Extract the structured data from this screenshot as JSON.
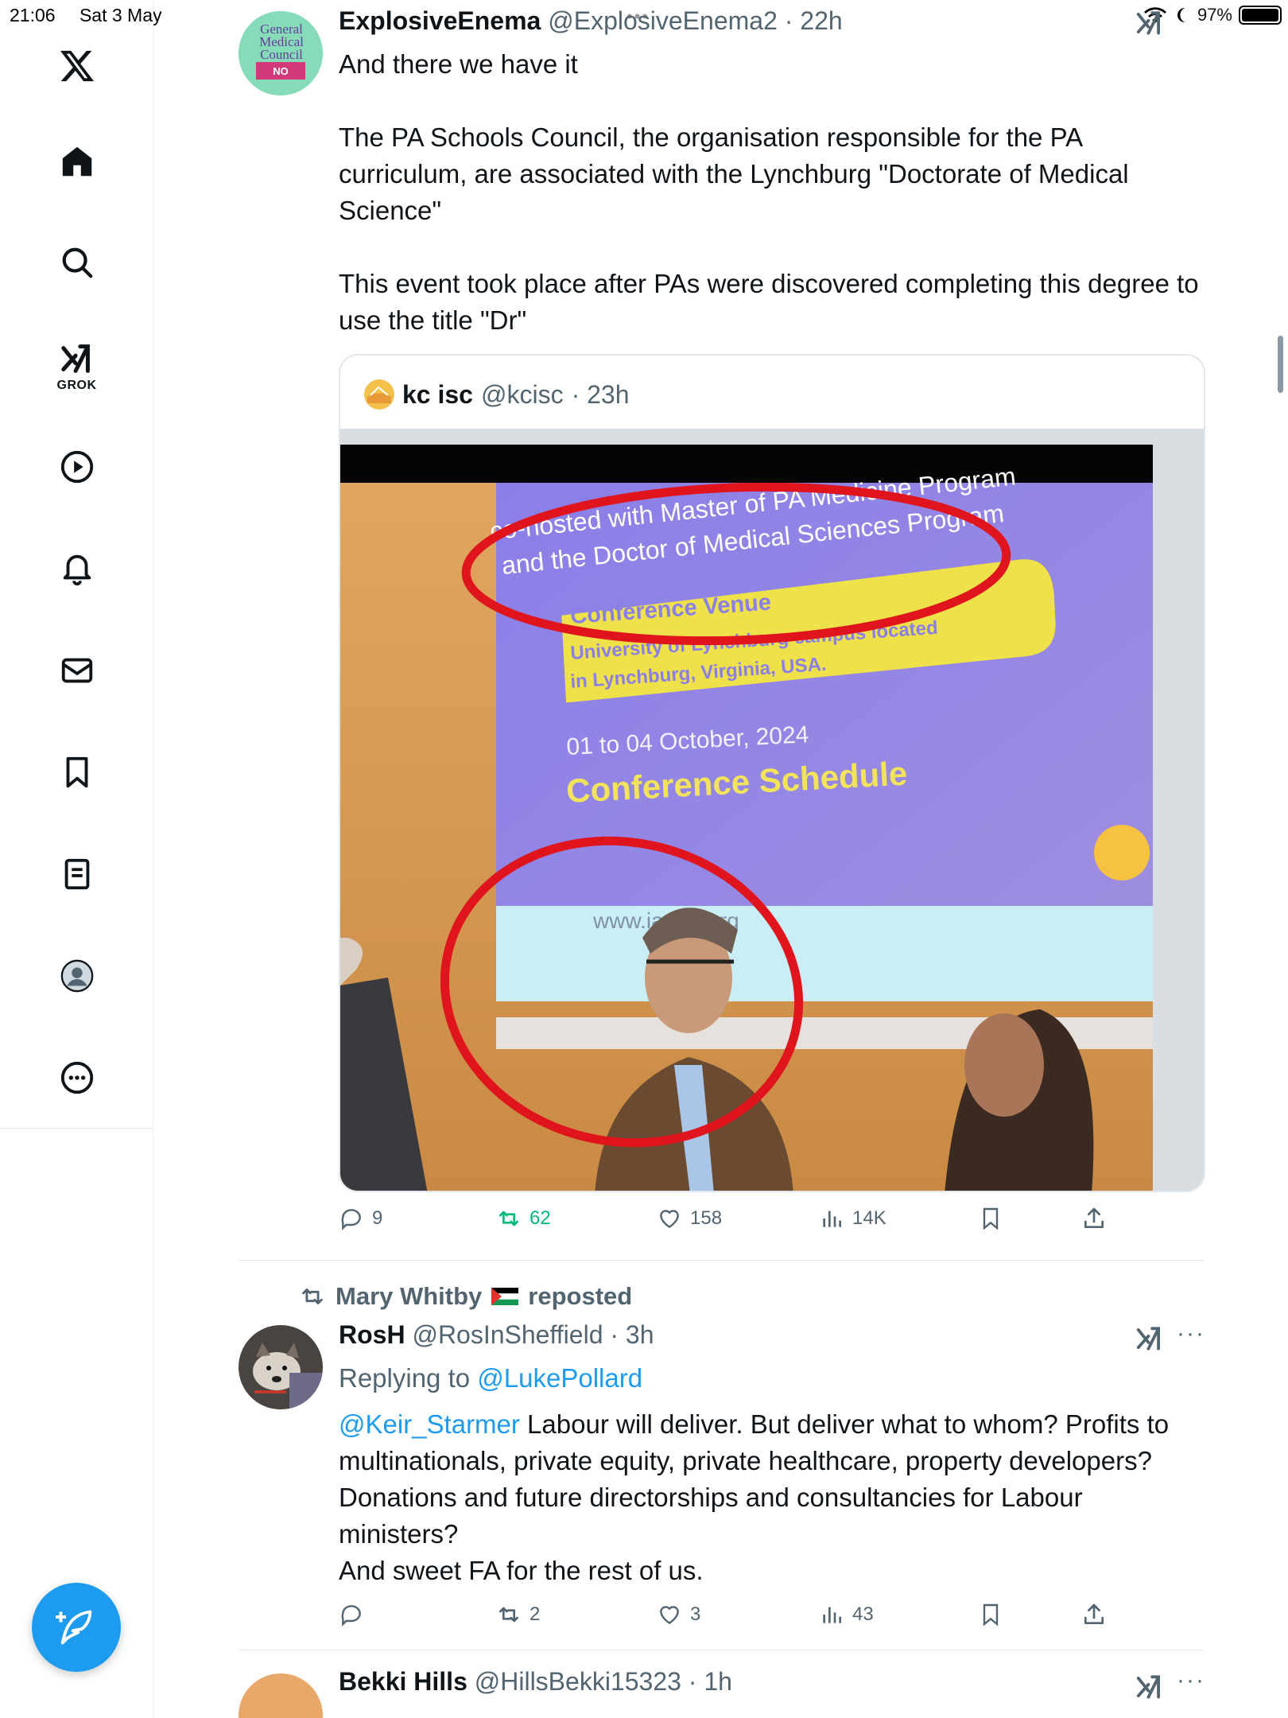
{
  "status": {
    "time": "21:06",
    "date": "Sat 3 May",
    "battery": "97%",
    "battery_level": 0.97
  },
  "sidebar": {
    "items": [
      {
        "icon": "x-logo-icon"
      },
      {
        "icon": "home-icon"
      },
      {
        "icon": "search-icon"
      },
      {
        "icon": "grok-icon",
        "label": "GROK"
      },
      {
        "icon": "play-icon"
      },
      {
        "icon": "bell-icon"
      },
      {
        "icon": "mail-icon"
      },
      {
        "icon": "bookmark-icon"
      },
      {
        "icon": "article-icon"
      },
      {
        "icon": "profile-icon"
      },
      {
        "icon": "more-circle-icon"
      }
    ],
    "compose_icon": "compose-feather-icon"
  },
  "posts": [
    {
      "name": "ExplosiveEnema",
      "handle": "@ExplosiveEnema2",
      "time": "· 22h",
      "paragraphs": [
        "And there we have it",
        "The PA Schools Council, the organisation responsible for the PA curriculum, are associated with the Lynchburg \"Doctorate of Medical Science\"",
        "This event took place after PAs were discovered completing this degree to use the title \"Dr\""
      ],
      "avatar_lines": [
        "General",
        "Medical",
        "Council"
      ],
      "avatar_badge": "NO",
      "quote": {
        "name": "kc isc",
        "handle": "@kcisc",
        "time": "· 23h",
        "slide": {
          "line1": "co-hosted with Master of PA Medicine Program",
          "line2": "and the Doctor of Medical Sciences Program",
          "venue_title": "Conference Venue",
          "venue_line1": "University of Lynchburg campus located",
          "venue_line2": "in Lynchburg, Virginia, USA.",
          "dates": "01 to 04 October, 2024",
          "schedule": "Conference Schedule",
          "url": "www.iapae.org"
        }
      },
      "stats": {
        "replies": "9",
        "reposts": "62",
        "likes": "158",
        "views": "14K"
      }
    },
    {
      "repost_by": "Mary Whitby",
      "repost_label": "reposted",
      "name": "RosH",
      "handle": "@RosInSheffield",
      "time": "· 3h",
      "replying_label": "Replying to",
      "replying_to": "@LukePollard",
      "mention": "@Keir_Starmer",
      "text_after_mention": " Labour will deliver. But deliver what to whom? Profits to multinationals, private equity, private healthcare, property developers? Donations and future directorships and consultancies for Labour ministers?",
      "text_last": "And sweet FA for the rest of us.",
      "stats": {
        "replies": "",
        "reposts": "2",
        "likes": "3",
        "views": "43"
      }
    },
    {
      "name": "Bekki Hills",
      "handle": "@HillsBekki15323",
      "time": "· 1h"
    }
  ],
  "colors": {
    "accent": "#1d9bf0",
    "repost": "#00ba7c",
    "muted": "#536471",
    "annotation": "#e0141c"
  }
}
